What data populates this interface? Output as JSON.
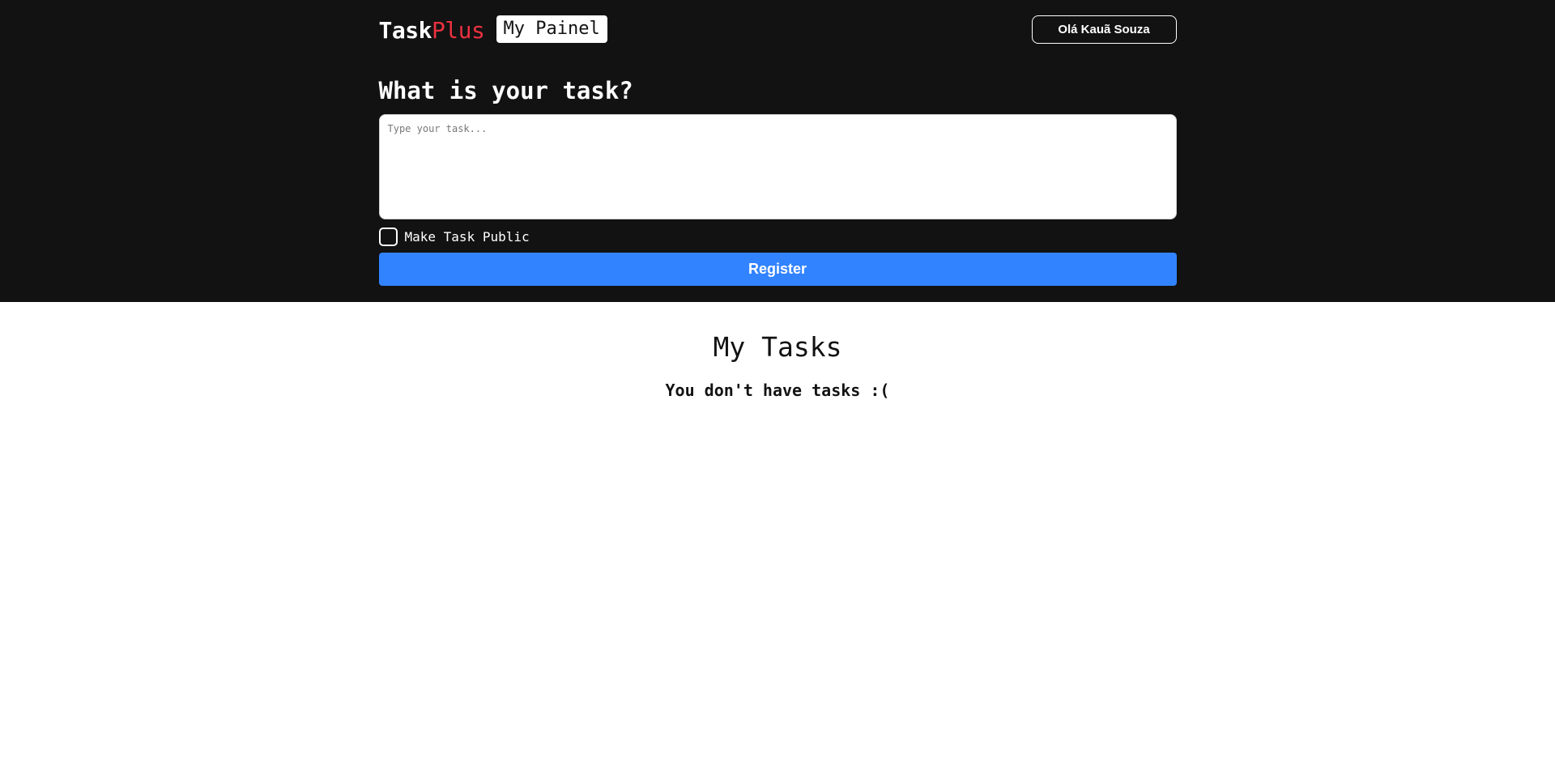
{
  "header": {
    "logo_main": "Task",
    "logo_accent": "Plus",
    "panel_label": "My Painel",
    "user_label": "Olá Kauã Souza"
  },
  "form": {
    "title": "What is your task?",
    "task_value": "",
    "task_placeholder": "Type your task...",
    "public_label": "Make Task Public",
    "public_checked": false,
    "register_label": "Register"
  },
  "tasks": {
    "title": "My Tasks",
    "empty_message": "You don't have tasks :(",
    "items": []
  },
  "colors": {
    "background_dark": "#121212",
    "accent_red": "#ea3140",
    "primary_blue": "#3183ff",
    "white": "#ffffff"
  }
}
